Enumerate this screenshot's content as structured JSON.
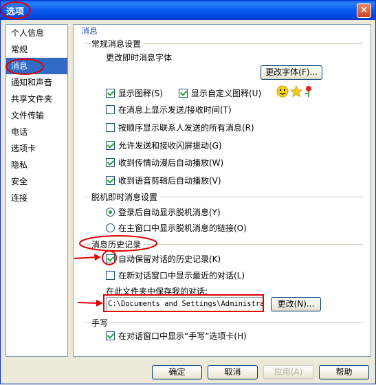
{
  "window": {
    "title": "选项",
    "close_glyph": "✕"
  },
  "sidebar": {
    "items": [
      {
        "label": "个人信息"
      },
      {
        "label": "常规"
      },
      {
        "label": "消息"
      },
      {
        "label": "通知和声音"
      },
      {
        "label": "共享文件夹"
      },
      {
        "label": "文件传输"
      },
      {
        "label": "电话"
      },
      {
        "label": "选项卡"
      },
      {
        "label": "隐私"
      },
      {
        "label": "安全"
      },
      {
        "label": "连接"
      }
    ],
    "selected": "消息"
  },
  "content": {
    "title": "消息",
    "general": {
      "heading": "常规消息设置",
      "font_label": "更改即时消息字体",
      "font_button": "更改字体(F)...",
      "show_emoticons": "显示图释(S)",
      "show_custom_emoticons": "显示自定义图释(U)",
      "show_timestamps": "在消息上显示发送/接收时间(T)",
      "show_all_sequential": "按顺序显示联系人发送的所有消息(R)",
      "allow_nudges": "允许发送和接收闪屏振动(G)",
      "autoplay_winks": "收到传情动漫后自动播放(W)",
      "autoplay_voice": "收到语音剪辑后自动播放(V)"
    },
    "offline": {
      "heading": "脱机即时消息设置",
      "auto_show": "登录后自动显示脱机消息(Y)",
      "show_link": "在主窗口中显示脱机消息的链接(O)"
    },
    "history": {
      "heading": "消息历史记录",
      "auto_keep": "自动保留对话的历史记录(K)",
      "show_recent": "在新对话窗口中显示最近的对话(L)",
      "save_folder_label": "在此文件夹中保存我的对话:",
      "save_folder_path": "C:\\Documents and Settings\\Administrat",
      "change_button": "更改(N)..."
    },
    "handwriting": {
      "heading": "手写",
      "show_tab": "在对话窗口中显示“手写”选项卡(H)"
    }
  },
  "footer": {
    "ok": "确定",
    "cancel": "取消",
    "apply": "应用(A)",
    "help": "帮助"
  },
  "colors": {
    "annotation": "#e00000",
    "selection": "#316ac5",
    "titlebar": "#0a5ef2"
  }
}
